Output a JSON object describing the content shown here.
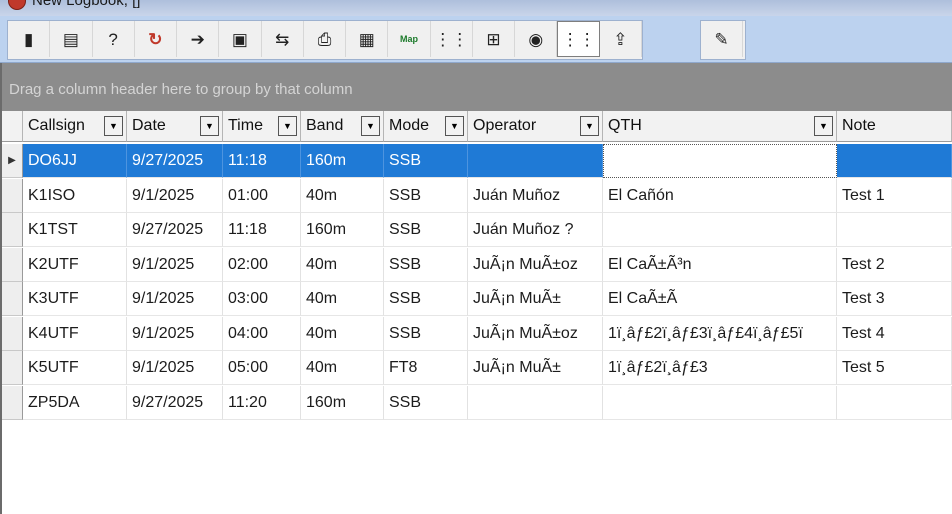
{
  "window": {
    "title": "New Logbook, []"
  },
  "toolbar": {
    "buttons": [
      {
        "name": "exit-icon",
        "glyph": "▮"
      },
      {
        "name": "new-logbook-icon",
        "glyph": "▤"
      },
      {
        "name": "help-icon",
        "glyph": "?"
      },
      {
        "name": "refresh-icon",
        "glyph": "↻"
      },
      {
        "name": "export-icon",
        "glyph": "➔"
      },
      {
        "name": "import-icon",
        "glyph": "▣"
      },
      {
        "name": "sort-icon",
        "glyph": "⇆"
      },
      {
        "name": "print-icon",
        "glyph": "⎙"
      },
      {
        "name": "chart-icon",
        "glyph": "▦"
      },
      {
        "name": "map-icon",
        "glyph": "Map"
      },
      {
        "name": "columns-icon",
        "glyph": "⋮⋮"
      },
      {
        "name": "layout-icon",
        "glyph": "⊞"
      },
      {
        "name": "radio-icon",
        "glyph": "◉"
      },
      {
        "name": "grid-toggle-icon",
        "glyph": "⋮⋮"
      },
      {
        "name": "upload-icon",
        "glyph": "⇪"
      },
      {
        "name": "cb-pen-icon",
        "glyph": "✎"
      }
    ]
  },
  "group_panel": {
    "text": "Drag a column header here to group by that column"
  },
  "table": {
    "headers": [
      "Callsign",
      "Date",
      "Time",
      "Band",
      "Mode",
      "Operator",
      "QTH",
      "Note"
    ],
    "rows": [
      [
        "DO6JJ",
        "9/27/2025",
        "11:18",
        "160m",
        "SSB",
        "",
        "",
        ""
      ],
      [
        "K1ISO",
        "9/1/2025",
        "01:00",
        "40m",
        "SSB",
        "Juán Muñoz",
        "El Cañón",
        "Test 1"
      ],
      [
        "K1TST",
        "9/27/2025",
        "11:18",
        "160m",
        "SSB",
        "Juán Muñoz ?",
        "",
        ""
      ],
      [
        "K2UTF",
        "9/1/2025",
        "02:00",
        "40m",
        "SSB",
        "JuÃ¡n MuÃ±oz",
        "El CaÃ±Ã³n",
        "Test 2"
      ],
      [
        "K3UTF",
        "9/1/2025",
        "03:00",
        "40m",
        "SSB",
        "JuÃ¡n MuÃ±",
        "El CaÃ±Ã",
        "Test 3"
      ],
      [
        "K4UTF",
        "9/1/2025",
        "04:00",
        "40m",
        "SSB",
        "JuÃ¡n MuÃ±oz",
        "1ï¸âƒ£2ï¸âƒ£3ï¸âƒ£4ï¸âƒ£5ï",
        "Test 4"
      ],
      [
        "K5UTF",
        "9/1/2025",
        "05:00",
        "40m",
        "FT8",
        "JuÃ¡n MuÃ±",
        "1ï¸âƒ£2ï¸âƒ£3",
        "Test 5"
      ],
      [
        "ZP5DA",
        "9/27/2025",
        "11:20",
        "160m",
        "SSB",
        "",
        "",
        ""
      ]
    ],
    "selected_row": 0
  },
  "colors": {
    "selection": "#1f7ad6",
    "toolbar_bg": "#bcd2ef",
    "group_panel_bg": "#8c8c8c"
  }
}
